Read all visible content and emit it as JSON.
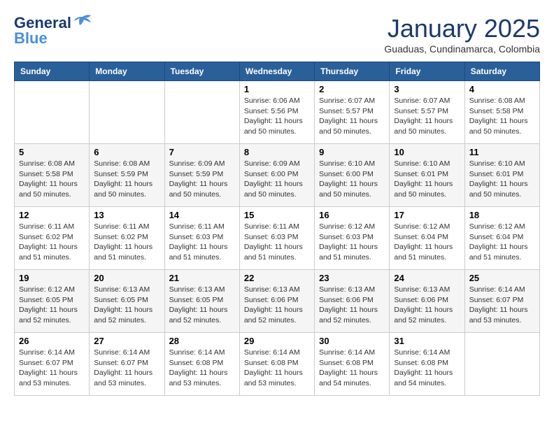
{
  "header": {
    "logo": {
      "line1": "General",
      "line2": "Blue"
    },
    "title": "January 2025",
    "subtitle": "Guaduas, Cundinamarca, Colombia"
  },
  "weekdays": [
    "Sunday",
    "Monday",
    "Tuesday",
    "Wednesday",
    "Thursday",
    "Friday",
    "Saturday"
  ],
  "weeks": [
    [
      null,
      null,
      null,
      {
        "day": "1",
        "sunrise": "6:06 AM",
        "sunset": "5:56 PM",
        "daylight": "11 hours and 50 minutes."
      },
      {
        "day": "2",
        "sunrise": "6:07 AM",
        "sunset": "5:57 PM",
        "daylight": "11 hours and 50 minutes."
      },
      {
        "day": "3",
        "sunrise": "6:07 AM",
        "sunset": "5:57 PM",
        "daylight": "11 hours and 50 minutes."
      },
      {
        "day": "4",
        "sunrise": "6:08 AM",
        "sunset": "5:58 PM",
        "daylight": "11 hours and 50 minutes."
      }
    ],
    [
      {
        "day": "5",
        "sunrise": "6:08 AM",
        "sunset": "5:58 PM",
        "daylight": "11 hours and 50 minutes."
      },
      {
        "day": "6",
        "sunrise": "6:08 AM",
        "sunset": "5:59 PM",
        "daylight": "11 hours and 50 minutes."
      },
      {
        "day": "7",
        "sunrise": "6:09 AM",
        "sunset": "5:59 PM",
        "daylight": "11 hours and 50 minutes."
      },
      {
        "day": "8",
        "sunrise": "6:09 AM",
        "sunset": "6:00 PM",
        "daylight": "11 hours and 50 minutes."
      },
      {
        "day": "9",
        "sunrise": "6:10 AM",
        "sunset": "6:00 PM",
        "daylight": "11 hours and 50 minutes."
      },
      {
        "day": "10",
        "sunrise": "6:10 AM",
        "sunset": "6:01 PM",
        "daylight": "11 hours and 50 minutes."
      },
      {
        "day": "11",
        "sunrise": "6:10 AM",
        "sunset": "6:01 PM",
        "daylight": "11 hours and 50 minutes."
      }
    ],
    [
      {
        "day": "12",
        "sunrise": "6:11 AM",
        "sunset": "6:02 PM",
        "daylight": "11 hours and 51 minutes."
      },
      {
        "day": "13",
        "sunrise": "6:11 AM",
        "sunset": "6:02 PM",
        "daylight": "11 hours and 51 minutes."
      },
      {
        "day": "14",
        "sunrise": "6:11 AM",
        "sunset": "6:03 PM",
        "daylight": "11 hours and 51 minutes."
      },
      {
        "day": "15",
        "sunrise": "6:11 AM",
        "sunset": "6:03 PM",
        "daylight": "11 hours and 51 minutes."
      },
      {
        "day": "16",
        "sunrise": "6:12 AM",
        "sunset": "6:03 PM",
        "daylight": "11 hours and 51 minutes."
      },
      {
        "day": "17",
        "sunrise": "6:12 AM",
        "sunset": "6:04 PM",
        "daylight": "11 hours and 51 minutes."
      },
      {
        "day": "18",
        "sunrise": "6:12 AM",
        "sunset": "6:04 PM",
        "daylight": "11 hours and 51 minutes."
      }
    ],
    [
      {
        "day": "19",
        "sunrise": "6:12 AM",
        "sunset": "6:05 PM",
        "daylight": "11 hours and 52 minutes."
      },
      {
        "day": "20",
        "sunrise": "6:13 AM",
        "sunset": "6:05 PM",
        "daylight": "11 hours and 52 minutes."
      },
      {
        "day": "21",
        "sunrise": "6:13 AM",
        "sunset": "6:05 PM",
        "daylight": "11 hours and 52 minutes."
      },
      {
        "day": "22",
        "sunrise": "6:13 AM",
        "sunset": "6:06 PM",
        "daylight": "11 hours and 52 minutes."
      },
      {
        "day": "23",
        "sunrise": "6:13 AM",
        "sunset": "6:06 PM",
        "daylight": "11 hours and 52 minutes."
      },
      {
        "day": "24",
        "sunrise": "6:13 AM",
        "sunset": "6:06 PM",
        "daylight": "11 hours and 52 minutes."
      },
      {
        "day": "25",
        "sunrise": "6:14 AM",
        "sunset": "6:07 PM",
        "daylight": "11 hours and 53 minutes."
      }
    ],
    [
      {
        "day": "26",
        "sunrise": "6:14 AM",
        "sunset": "6:07 PM",
        "daylight": "11 hours and 53 minutes."
      },
      {
        "day": "27",
        "sunrise": "6:14 AM",
        "sunset": "6:07 PM",
        "daylight": "11 hours and 53 minutes."
      },
      {
        "day": "28",
        "sunrise": "6:14 AM",
        "sunset": "6:08 PM",
        "daylight": "11 hours and 53 minutes."
      },
      {
        "day": "29",
        "sunrise": "6:14 AM",
        "sunset": "6:08 PM",
        "daylight": "11 hours and 53 minutes."
      },
      {
        "day": "30",
        "sunrise": "6:14 AM",
        "sunset": "6:08 PM",
        "daylight": "11 hours and 54 minutes."
      },
      {
        "day": "31",
        "sunrise": "6:14 AM",
        "sunset": "6:08 PM",
        "daylight": "11 hours and 54 minutes."
      },
      null
    ]
  ],
  "labels": {
    "sunrise": "Sunrise:",
    "sunset": "Sunset:",
    "daylight": "Daylight:"
  }
}
